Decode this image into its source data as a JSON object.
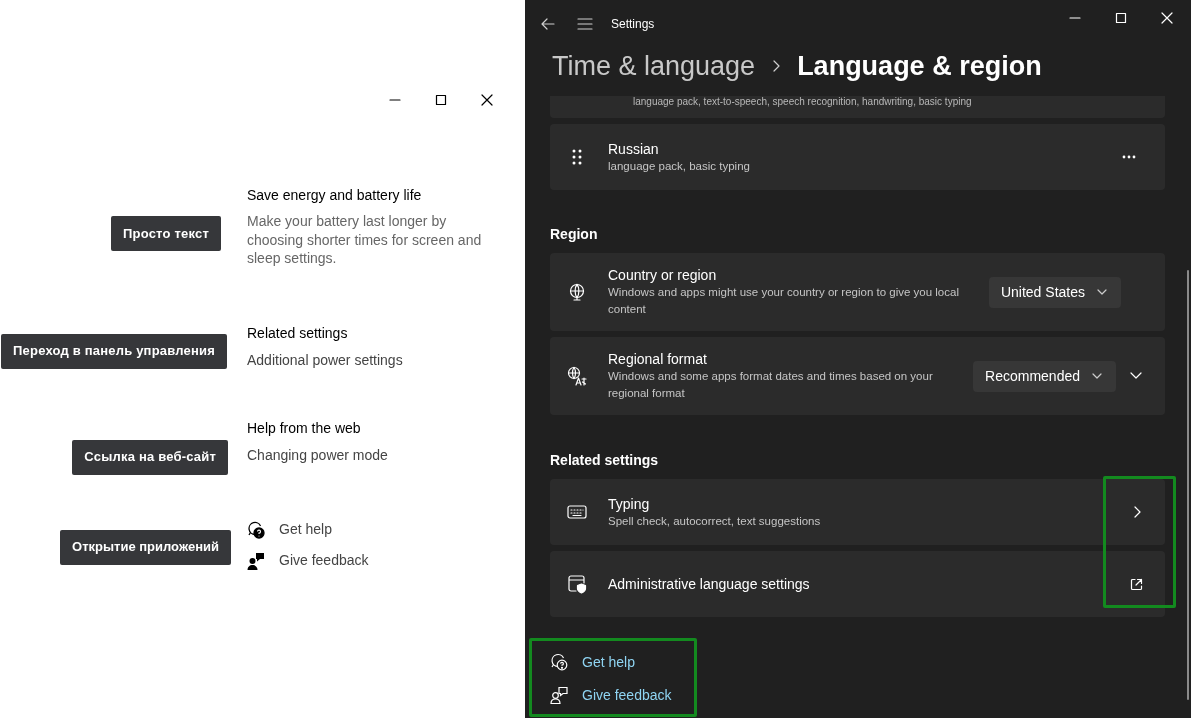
{
  "left_window": {
    "sections": [
      {
        "kind": "text",
        "title": "Save energy and battery life",
        "body": "Make your battery last longer by choosing shorter times for screen and sleep settings.",
        "callout": "Просто текст"
      },
      {
        "kind": "link",
        "title": "Related settings",
        "body": "Additional power settings",
        "callout": "Переход в панель управления"
      },
      {
        "kind": "link",
        "title": "Help from the web",
        "body": "Changing power mode",
        "callout": "Ссылка на веб-сайт"
      }
    ],
    "links": [
      {
        "kind": "help",
        "label": "Get help"
      },
      {
        "kind": "feedback",
        "label": "Give feedback"
      }
    ],
    "links_callout": "Открытие приложений"
  },
  "settings_window": {
    "title": "Settings",
    "breadcrumb": [
      "Time & language",
      "Language & region"
    ],
    "partial_card_text": "language pack, text-to-speech, speech recognition, handwriting, basic typing",
    "groups": [
      {
        "rows": [
          {
            "kind": "drag",
            "title": "Russian",
            "subtitle": "language pack, basic typing",
            "more_menu": true
          }
        ]
      },
      {
        "heading": "Region",
        "rows": [
          {
            "kind": "globe",
            "title": "Country or region",
            "subtitle": "Windows and apps might use your country or region to give you local content",
            "dropdown": "United States"
          },
          {
            "kind": "format",
            "title": "Regional format",
            "subtitle": "Windows and some apps format dates and times based on your regional format",
            "dropdown": "Recommended",
            "expanded": false
          }
        ]
      },
      {
        "heading": "Related settings",
        "rows": [
          {
            "kind": "keyboard",
            "title": "Typing",
            "subtitle": "Spell check, autocorrect, text suggestions",
            "opens_page": true
          },
          {
            "kind": "admin",
            "title": "Administrative language settings",
            "external_link": true
          }
        ]
      }
    ],
    "links": [
      {
        "kind": "help",
        "label": "Get help"
      },
      {
        "kind": "feedback",
        "label": "Give feedback"
      }
    ]
  }
}
